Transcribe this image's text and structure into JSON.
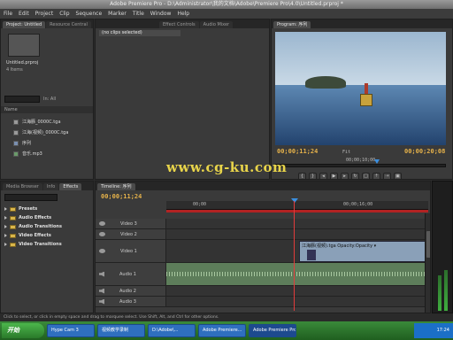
{
  "window": {
    "title": "Adobe Premiere Pro - D:\\Administrator\\我的文档\\Adobe\\Premiere Pro\\4.0\\Untitled.prproj *"
  },
  "menu": [
    "File",
    "Edit",
    "Project",
    "Clip",
    "Sequence",
    "Marker",
    "Title",
    "Window",
    "Help"
  ],
  "project": {
    "tabs": [
      "Project: Untitled",
      "Resource Central"
    ],
    "name": "Untitled.prproj",
    "count": "4 Items",
    "in_label": "In:",
    "in_value": "All",
    "header": "Name",
    "items": [
      {
        "icon": "video-file-icon",
        "label": "江海豚_0000C.tga"
      },
      {
        "icon": "video-file-icon",
        "label": "江海(视频)_0000C.tga"
      },
      {
        "icon": "sequence-icon",
        "label": "序列"
      },
      {
        "icon": "audio-file-icon",
        "label": "音乐.mp3"
      }
    ]
  },
  "source": {
    "tabs": [
      "Effect Controls",
      "Audio Mixer"
    ],
    "message": "(no clips selected)"
  },
  "program": {
    "tab": "Program: 序列",
    "timecode_current": "00;00;11;24",
    "timecode_duration": "00;00;20;08",
    "fit": "Fit",
    "ruler_mid": "00;00;10;00"
  },
  "effects": {
    "tabs": [
      "Media Browser",
      "Info",
      "Effects"
    ],
    "items": [
      "Presets",
      "Audio Effects",
      "Audio Transitions",
      "Video Effects",
      "Video Transitions"
    ]
  },
  "timeline": {
    "tab": "Timeline: 序列",
    "timecode": "00;00;11;24",
    "ruler_labels": [
      "00;00",
      "00;00;16;00"
    ],
    "tracks": [
      {
        "name": "Video 3",
        "type": "video"
      },
      {
        "name": "Video 2",
        "type": "video"
      },
      {
        "name": "Video 1",
        "type": "video"
      },
      {
        "name": "Audio 1",
        "type": "audio"
      },
      {
        "name": "Audio 2",
        "type": "audio"
      },
      {
        "name": "Audio 3",
        "type": "audio"
      }
    ],
    "clip_label": "江海豚(视频).tga  Opacity:Opacity ▾"
  },
  "status_text": "Click to select, or click in empty space and drag to marquee select. Use Shift, Alt, and Ctrl for other options.",
  "watermark": "www.cg-ku.com",
  "taskbar": {
    "start": "开始",
    "tasks": [
      "Hype Cam 3",
      "视频教学录制",
      "D:\\Adobe\\...",
      "Adobe Premiere...",
      "Adobe Premiere Pro"
    ],
    "clock": "17:24"
  }
}
